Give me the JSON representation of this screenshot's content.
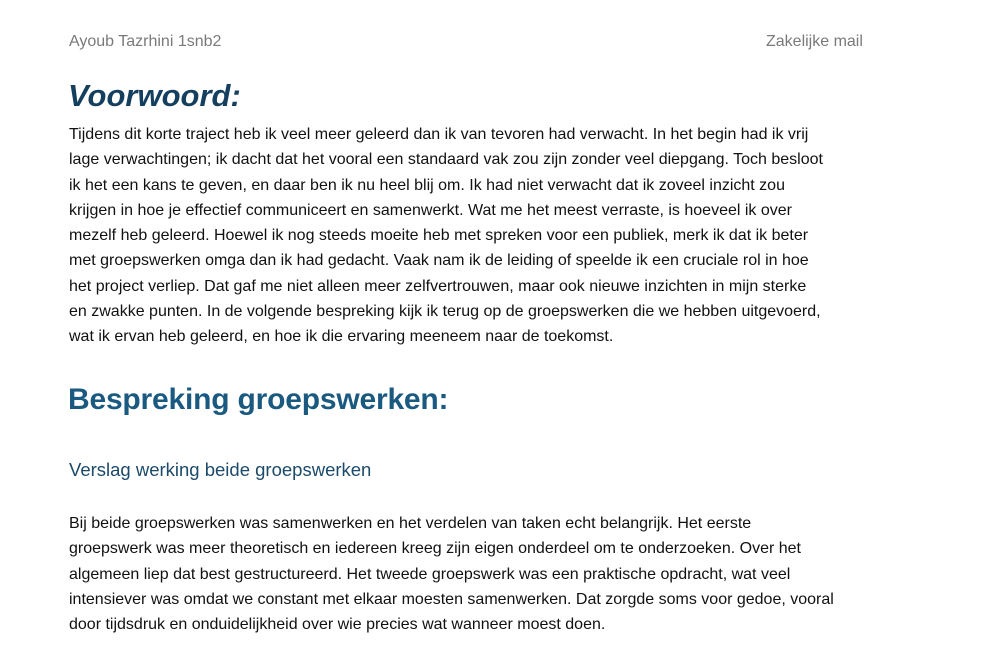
{
  "header": {
    "author": "Ayoub Tazrhini 1snb2",
    "doc_type": "Zakelijke mail"
  },
  "voorwoord": {
    "heading": "Voorwoord:",
    "lines": [
      "Tijdens dit korte traject heb ik veel meer geleerd dan ik van tevoren had verwacht. In het begin had ik vrij",
      "lage verwachtingen; ik dacht dat het vooral een standaard vak zou zijn zonder veel diepgang. Toch besloot",
      "ik het een kans te geven, en daar ben ik nu heel blij om. Ik had niet verwacht dat ik zoveel inzicht zou",
      "krijgen in hoe je effectief communiceert en samenwerkt. Wat me het meest verraste, is hoeveel ik over",
      "mezelf heb geleerd. Hoewel ik nog steeds moeite heb met spreken voor een publiek, merk ik dat ik beter",
      "met groepswerken omga dan ik had gedacht. Vaak nam ik de leiding of speelde ik een cruciale rol in hoe",
      "het project verliep. Dat gaf me niet alleen meer zelfvertrouwen, maar ook nieuwe inzichten in mijn sterke",
      "en zwakke punten. In de volgende bespreking kijk ik terug op de groepswerken die we hebben uitgevoerd,",
      "wat ik ervan heb geleerd, en hoe ik die ervaring meeneem naar de toekomst."
    ]
  },
  "bespreking": {
    "heading": "Bespreking groepswerken:",
    "subheading": "Verslag werking beide groepswerken",
    "lines": [
      "Bij beide groepswerken was samenwerken en het verdelen van taken echt belangrijk. Het eerste",
      "groepswerk was meer theoretisch en iedereen kreeg zijn eigen onderdeel om te onderzoeken. Over het",
      "algemeen liep dat best gestructureerd. Het tweede groepswerk was een praktische opdracht, wat veel",
      "intensiever was omdat we constant met elkaar moesten samenwerken. Dat zorgde soms voor gedoe, vooral",
      "door tijdsdruk en onduidelijkheid over wie precies wat wanneer moest doen."
    ]
  }
}
